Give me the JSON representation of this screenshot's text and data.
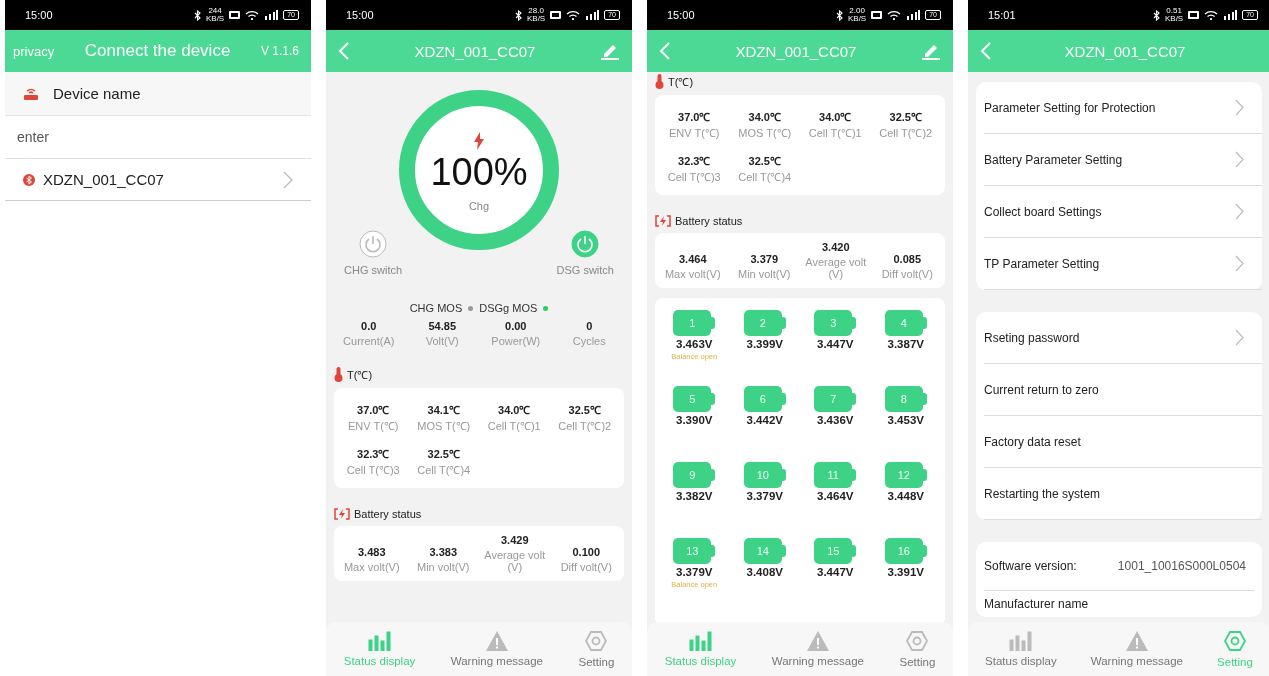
{
  "phones": [
    {
      "kind": "connect",
      "status": {
        "time": "15:00",
        "speed": "244",
        "speed_unit": "KB/S",
        "battery": "70"
      },
      "header": {
        "left": "privacy",
        "title": "Connect the device",
        "right": "V 1.1.6"
      },
      "section_title": "Device name",
      "search": {
        "placeholder": "enter"
      },
      "devices": [
        {
          "name": "XDZN_001_CC07"
        }
      ]
    },
    {
      "kind": "status",
      "status": {
        "time": "15:00",
        "speed": "28.0",
        "speed_unit": "KB/S",
        "battery": "70"
      },
      "header": {
        "title": "XDZN_001_CC07",
        "edit": true
      },
      "gauge": {
        "percent": "100%",
        "label": "Chg",
        "level": 1
      },
      "switches": [
        {
          "label": "CHG switch",
          "on": false
        },
        {
          "label": "DSG switch",
          "on": true
        }
      ],
      "mos": [
        {
          "label": "CHG MOS",
          "on": false
        },
        {
          "label": "DSGg MOS",
          "on": true
        }
      ],
      "stats": [
        {
          "value": "0.0",
          "label": "Current(A)"
        },
        {
          "value": "54.85",
          "label": "Volt(V)"
        },
        {
          "value": "0.00",
          "label": "Power(W)"
        },
        {
          "value": "0",
          "label": "Cycles"
        }
      ],
      "temp_title": "T(℃)",
      "temps": [
        {
          "value": "37.0℃",
          "label": "ENV T(℃)"
        },
        {
          "value": "34.1℃",
          "label": "MOS T(℃)"
        },
        {
          "value": "34.0℃",
          "label": "Cell T(℃)1"
        },
        {
          "value": "32.5℃",
          "label": "Cell T(℃)2"
        },
        {
          "value": "32.3℃",
          "label": "Cell T(℃)3"
        },
        {
          "value": "32.5℃",
          "label": "Cell T(℃)4"
        }
      ],
      "battery_title": "Battery status",
      "volts": [
        {
          "value": "3.483",
          "label": "Max volt(V)"
        },
        {
          "value": "3.383",
          "label": "Min volt(V)"
        },
        {
          "value": "3.429",
          "label": "Average volt (V)"
        },
        {
          "value": "0.100",
          "label": "Diff volt(V)"
        }
      ],
      "nav": [
        {
          "label": "Status display",
          "selected": true
        },
        {
          "label": "Warning message",
          "selected": false
        },
        {
          "label": "Setting",
          "selected": false
        }
      ]
    },
    {
      "kind": "cells",
      "status": {
        "time": "15:00",
        "speed": "2.00",
        "speed_unit": "KB/S",
        "battery": "70"
      },
      "header": {
        "title": "XDZN_001_CC07",
        "edit": true
      },
      "temp_title": "T(℃)",
      "temps": [
        {
          "value": "37.0℃",
          "label": "ENV T(℃)"
        },
        {
          "value": "34.0℃",
          "label": "MOS T(℃)"
        },
        {
          "value": "34.0℃",
          "label": "Cell T(℃)1"
        },
        {
          "value": "32.5℃",
          "label": "Cell T(℃)2"
        },
        {
          "value": "32.3℃",
          "label": "Cell T(℃)3"
        },
        {
          "value": "32.5℃",
          "label": "Cell T(℃)4"
        }
      ],
      "battery_title": "Battery status",
      "volts": [
        {
          "value": "3.464",
          "label": "Max volt(V)"
        },
        {
          "value": "3.379",
          "label": "Min volt(V)"
        },
        {
          "value": "3.420",
          "label": "Average volt (V)"
        },
        {
          "value": "0.085",
          "label": "Diff volt(V)"
        }
      ],
      "cells": [
        {
          "index": "1",
          "voltage": "3.463V",
          "note": "Balance open"
        },
        {
          "index": "2",
          "voltage": "3.399V"
        },
        {
          "index": "3",
          "voltage": "3.447V"
        },
        {
          "index": "4",
          "voltage": "3.387V"
        },
        {
          "index": "5",
          "voltage": "3.390V"
        },
        {
          "index": "6",
          "voltage": "3.442V"
        },
        {
          "index": "7",
          "voltage": "3.436V"
        },
        {
          "index": "8",
          "voltage": "3.453V"
        },
        {
          "index": "9",
          "voltage": "3.382V"
        },
        {
          "index": "10",
          "voltage": "3.379V"
        },
        {
          "index": "11",
          "voltage": "3.464V"
        },
        {
          "index": "12",
          "voltage": "3.448V"
        },
        {
          "index": "13",
          "voltage": "3.379V",
          "note": "Balance open"
        },
        {
          "index": "14",
          "voltage": "3.408V"
        },
        {
          "index": "15",
          "voltage": "3.447V"
        },
        {
          "index": "16",
          "voltage": "3.391V"
        }
      ],
      "nav": [
        {
          "label": "Status display",
          "selected": true
        },
        {
          "label": "Warning message",
          "selected": false
        },
        {
          "label": "Setting",
          "selected": false
        }
      ]
    },
    {
      "kind": "settings",
      "status": {
        "time": "15:01",
        "speed": "0.51",
        "speed_unit": "KB/S",
        "battery": "70"
      },
      "header": {
        "title": "XDZN_001_CC07",
        "edit": false
      },
      "groups": [
        [
          {
            "label": "Parameter Setting for Protection",
            "arrow": true
          },
          {
            "label": "Battery Parameter Setting",
            "arrow": true
          },
          {
            "label": "Collect board Settings",
            "arrow": true
          },
          {
            "label": "TP Parameter Setting",
            "arrow": true
          }
        ],
        [
          {
            "label": "Rseting password",
            "arrow": true
          },
          {
            "label": "Current return to zero",
            "arrow": false
          },
          {
            "label": "Factory data reset",
            "arrow": false
          },
          {
            "label": "Restarting the system",
            "arrow": false
          }
        ]
      ],
      "info": [
        {
          "label": "Software version:",
          "value": "1001_10016S000L0504"
        },
        {
          "label": "Manufacturer name"
        }
      ],
      "nav": [
        {
          "label": "Status display",
          "selected": false
        },
        {
          "label": "Warning message",
          "selected": false
        },
        {
          "label": "Setting",
          "selected": true
        }
      ]
    }
  ]
}
